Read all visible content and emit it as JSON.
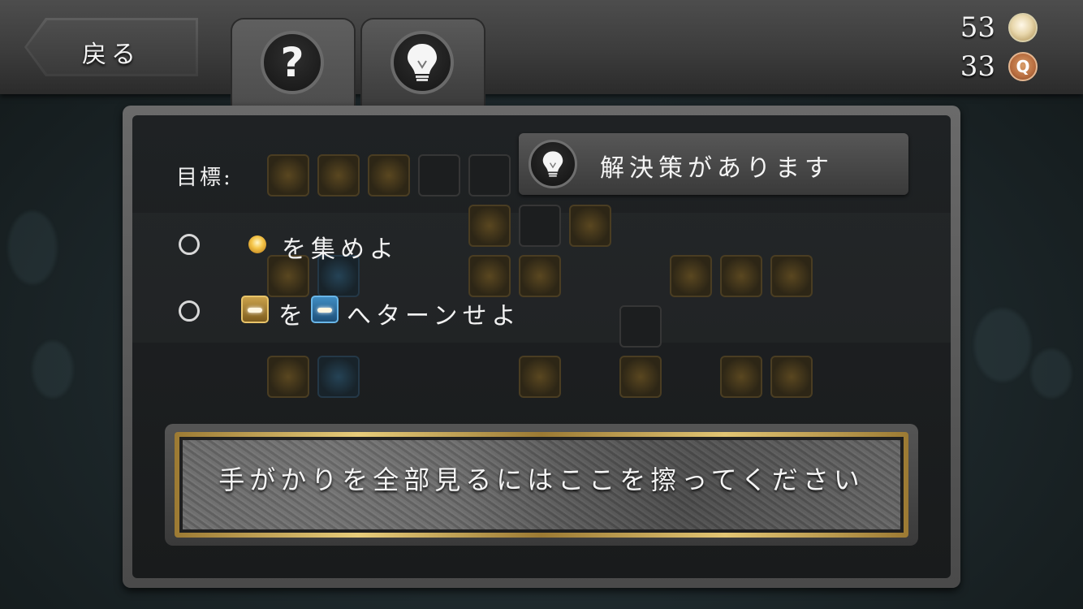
{
  "topbar": {
    "back_label": "戻る",
    "tabs": [
      {
        "icon": "question-icon",
        "active": true
      },
      {
        "icon": "lightbulb-icon",
        "active": false
      }
    ],
    "currency": [
      {
        "value": "53",
        "icon": "gold-coin-icon"
      },
      {
        "value": "33",
        "icon": "q-coin-icon"
      }
    ]
  },
  "panel": {
    "goal_label": "目標:",
    "solution_button_label": "解決策があります",
    "objectives": [
      {
        "text": "を集めよ",
        "icon": "gold-orb-icon"
      },
      {
        "text_1": "を",
        "text_2": "へターンせよ",
        "icon_from": "gold-tile-icon",
        "icon_to": "blue-tile-icon"
      }
    ],
    "scratch_label": "手がかりを全部見るにはここを擦ってください"
  },
  "colors": {
    "panel_bg": "#1f2224",
    "gold_accent": "#e8cd7b",
    "blue_accent": "#3f8cc2"
  }
}
